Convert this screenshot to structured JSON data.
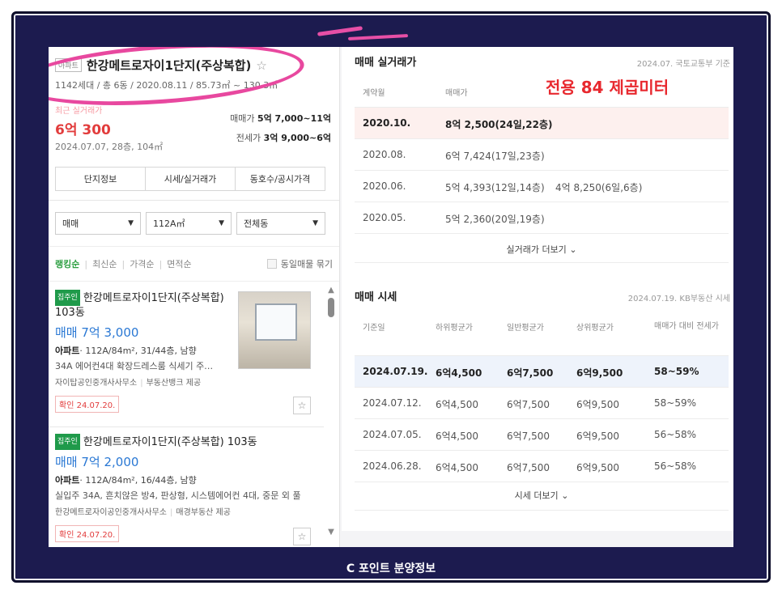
{
  "caption": "C 포인트 분양정보",
  "complex": {
    "type_badge": "아파트",
    "name": "한강메트로자이1단지(주상복합)",
    "meta": "1142세대 / 총 6동 / 2020.08.11 / 85.73㎡ ~ 130.3㎡",
    "recent_label": "최근 실거래가",
    "recent_price": "6억 300",
    "recent_date": "2024.07.07, 28층, 104㎡",
    "sale_range_label": "매매가",
    "sale_range_value": "5억 7,000~11억",
    "jeonse_range_label": "전세가",
    "jeonse_range_value": "3억 9,000~6억"
  },
  "tabs": [
    "단지정보",
    "시세/실거래가",
    "동호수/공시가격"
  ],
  "filters": {
    "deal_type": "매매",
    "area": "112A㎡",
    "building": "전체동"
  },
  "sort": {
    "options": [
      "랭킹순",
      "최신순",
      "가격순",
      "면적순"
    ],
    "group_label": "동일매물 묶기"
  },
  "listings": [
    {
      "tag": "집주인",
      "title": "한강메트로자이1단지(주상복합) 103동",
      "price": "매매 7억 3,000",
      "spec_type": "아파트",
      "spec": "· 112A/84m², 31/44층, 남향",
      "desc": "34A 에어컨4대 확장드레스룸 식세기 주…",
      "agent": "자이탑공인중개사사무소",
      "provider": "부동산뱅크 제공",
      "confirm": "확인 24.07.20."
    },
    {
      "tag": "집주인",
      "title": "한강메트로자이1단지(주상복합) 103동",
      "price": "매매 7억 2,000",
      "spec_type": "아파트",
      "spec": "· 112A/84m², 16/44층, 남향",
      "desc": "실입주 34A, 흔치않은 방4, 판상형, 시스템에어컨 4대, 중문 외 풀",
      "agent": "한강메트로자이공인중개사사무소",
      "provider": "매경부동산 제공",
      "confirm": "확인 24.07.20."
    }
  ],
  "transactions": {
    "title": "매매 실거래가",
    "source": "2024.07. 국토교통부 기준",
    "annotation": "전용 84 제곱미터",
    "headers": [
      "계약월",
      "매매가"
    ],
    "rows": [
      {
        "month": "2020.10.",
        "price": "8억 2,500(24일,22층)",
        "price2": ""
      },
      {
        "month": "2020.08.",
        "price": "6억 7,424(17일,23층)",
        "price2": ""
      },
      {
        "month": "2020.06.",
        "price": "5억 4,393(12일,14층)",
        "price2": "4억 8,250(6일,6층)"
      },
      {
        "month": "2020.05.",
        "price": "5억 2,360(20일,19층)",
        "price2": ""
      }
    ],
    "more": "실거래가 더보기"
  },
  "market": {
    "title": "매매 시세",
    "source": "2024.07.19. KB부동산 시세",
    "headers": [
      "기준일",
      "하위평균가",
      "일반평균가",
      "상위평균가",
      "매매가 대비 전세가"
    ],
    "rows": [
      [
        "2024.07.19.",
        "6억4,500",
        "6억7,500",
        "6억9,500",
        "58~59%"
      ],
      [
        "2024.07.12.",
        "6억4,500",
        "6억7,500",
        "6억9,500",
        "58~59%"
      ],
      [
        "2024.07.05.",
        "6억4,500",
        "6억7,500",
        "6억9,500",
        "56~58%"
      ],
      [
        "2024.06.28.",
        "6억4,500",
        "6억7,500",
        "6억9,500",
        "56~58%"
      ]
    ],
    "more": "시세 더보기"
  }
}
